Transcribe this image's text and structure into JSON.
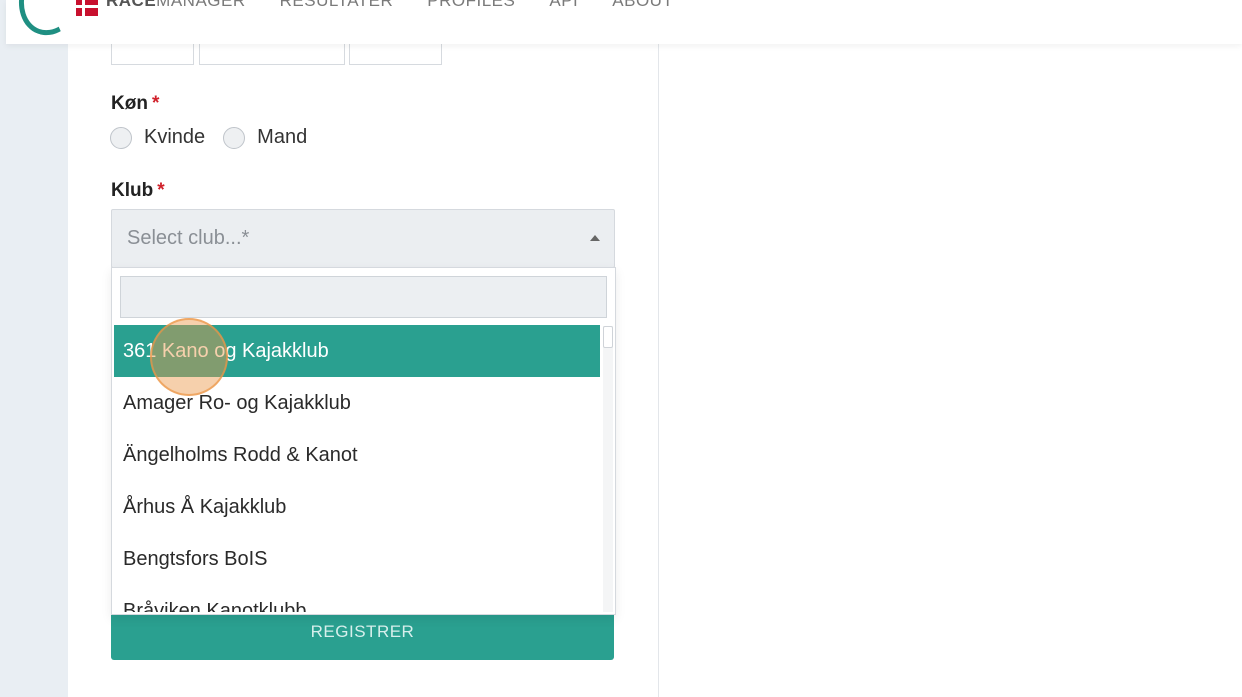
{
  "nav": {
    "brand_bold": "RACE",
    "brand_rest": "MANAGER",
    "items": [
      "RESULTATER",
      "PROFILES",
      "API",
      "ABOUT"
    ]
  },
  "form": {
    "gender_label": "Køn",
    "gender_options": [
      "Kvinde",
      "Mand"
    ],
    "club_label": "Klub",
    "required_mark": "*",
    "club_select": {
      "placeholder": "Select club...*",
      "search_value": "",
      "options": [
        "361 Kano og Kajakklub",
        "Amager Ro- og Kajakklub",
        "Ängelholms Rodd & Kanot",
        "Århus Å Kajakklub",
        "Bengtsfors BoIS",
        "Bråviken Kanotklubb"
      ],
      "highlighted_index": 0
    },
    "submit_label": "REGISTRER"
  },
  "colors": {
    "accent": "#2aa090",
    "required": "#d0202a"
  }
}
